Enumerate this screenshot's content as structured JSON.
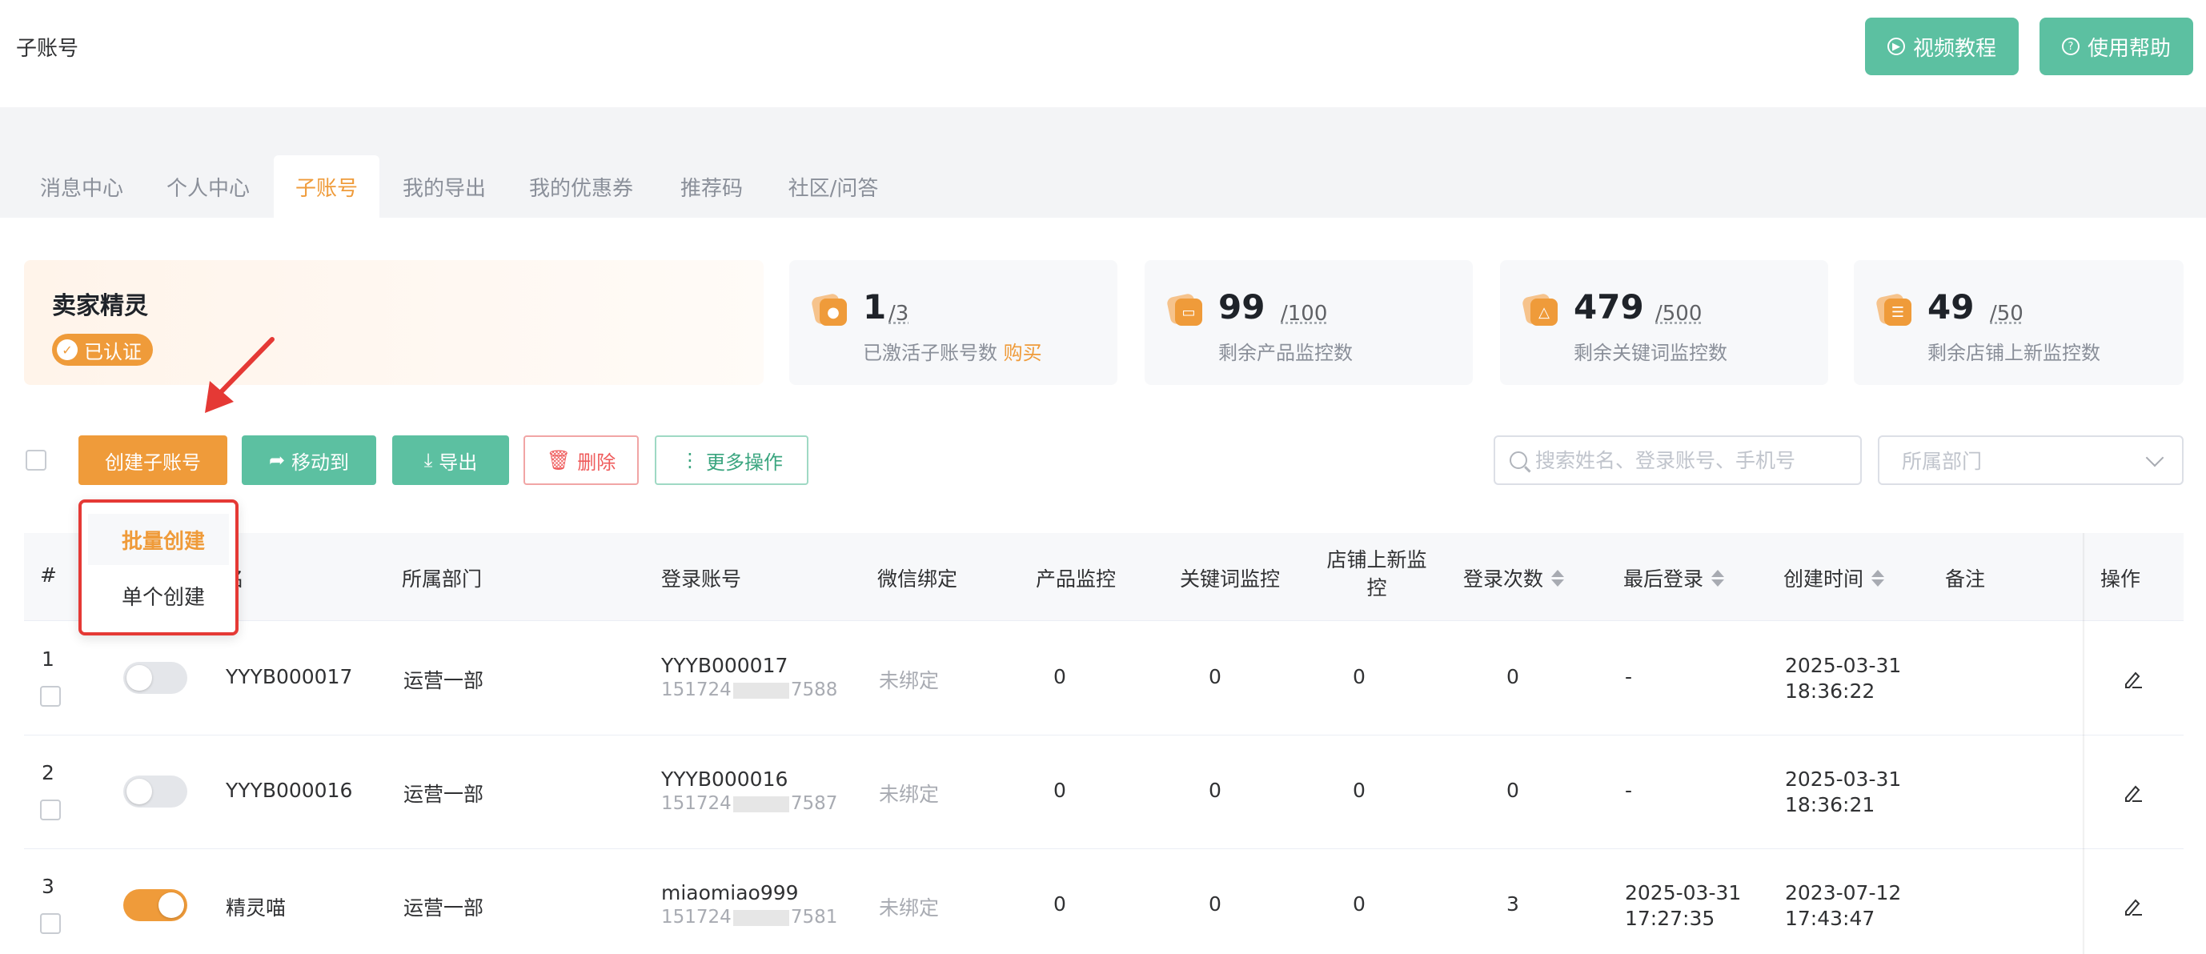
{
  "header": {
    "title": "子账号",
    "video_tutorial": "视频教程",
    "help": "使用帮助"
  },
  "tabs": [
    {
      "label": "消息中心"
    },
    {
      "label": "个人中心"
    },
    {
      "label": "子账号",
      "active": true
    },
    {
      "label": "我的导出"
    },
    {
      "label": "我的优惠券"
    },
    {
      "label": "推荐码"
    },
    {
      "label": "社区/问答"
    }
  ],
  "seller": {
    "name": "卖家精灵",
    "badge": "已认证"
  },
  "stats": [
    {
      "value": "1",
      "total": "/3",
      "label": "已激活子账号数",
      "action": "购买"
    },
    {
      "value": "99",
      "total": "/100",
      "label": "剩余产品监控数"
    },
    {
      "value": "479",
      "total": "/500",
      "label": "剩余关键词监控数"
    },
    {
      "value": "49",
      "total": "/50",
      "label": "剩余店铺上新监控数"
    }
  ],
  "toolbar": {
    "create": "创建子账号",
    "move": "移动到",
    "export": "导出",
    "delete": "删除",
    "more": "更多操作",
    "search_placeholder": "搜索姓名、登录账号、手机号",
    "dept_placeholder": "所属部门"
  },
  "dropdown": {
    "batch": "批量创建",
    "single": "单个创建"
  },
  "table": {
    "headers": {
      "index": "#",
      "name": "姓名",
      "name_visible": "名",
      "dept": "所属部门",
      "account": "登录账号",
      "wechat": "微信绑定",
      "product": "产品监控",
      "keyword": "关键词监控",
      "store_line1": "店铺上新监",
      "store_line2": "控",
      "logins": "登录次数",
      "last_login": "最后登录",
      "created": "创建时间",
      "note": "备注",
      "ops": "操作"
    },
    "rows": [
      {
        "index": "1",
        "enabled": false,
        "name": "YYYB000017",
        "dept": "运营一部",
        "account": "YYYB000017",
        "phone_a": "151724",
        "phone_b": "7588",
        "wechat": "未绑定",
        "product": "0",
        "keyword": "0",
        "store": "0",
        "logins": "0",
        "last_login_1": "-",
        "last_login_2": "",
        "created_1": "2025-03-31",
        "created_2": "18:36:22"
      },
      {
        "index": "2",
        "enabled": false,
        "name": "YYYB000016",
        "dept": "运营一部",
        "account": "YYYB000016",
        "phone_a": "151724",
        "phone_b": "7587",
        "wechat": "未绑定",
        "product": "0",
        "keyword": "0",
        "store": "0",
        "logins": "0",
        "last_login_1": "-",
        "last_login_2": "",
        "created_1": "2025-03-31",
        "created_2": "18:36:21"
      },
      {
        "index": "3",
        "enabled": true,
        "name": "精灵喵",
        "dept": "运营一部",
        "account": "miaomiao999",
        "phone_a": "151724",
        "phone_b": "7581",
        "wechat": "未绑定",
        "product": "0",
        "keyword": "0",
        "store": "0",
        "logins": "3",
        "last_login_1": "2025-03-31",
        "last_login_2": "17:27:35",
        "created_1": "2023-07-12",
        "created_2": "17:43:47"
      }
    ]
  },
  "colors": {
    "accent": "#ef9b3a",
    "green": "#5cc0a1",
    "danger": "#ef5b5b",
    "annotation": "#e53935"
  }
}
